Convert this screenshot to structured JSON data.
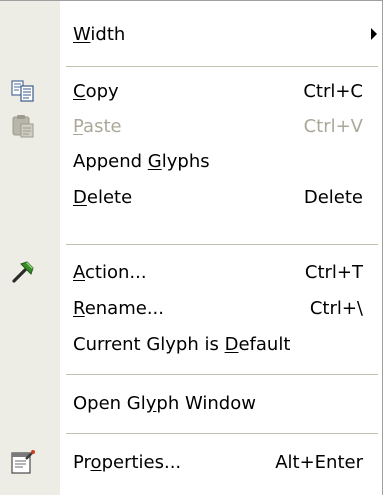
{
  "menu": {
    "items": [
      {
        "label": "Width",
        "mnemonic_index": 0,
        "shortcut": "",
        "submenu": true,
        "disabled": false,
        "icon": ""
      },
      {
        "label": "Copy",
        "mnemonic_index": 0,
        "shortcut": "Ctrl+C",
        "submenu": false,
        "disabled": false,
        "icon": "copy-icon"
      },
      {
        "label": "Paste",
        "mnemonic_index": 0,
        "shortcut": "Ctrl+V",
        "submenu": false,
        "disabled": true,
        "icon": "paste-icon"
      },
      {
        "label": "Append Glyphs",
        "mnemonic_index": 7,
        "shortcut": "",
        "submenu": false,
        "disabled": false,
        "icon": ""
      },
      {
        "label": "Delete",
        "mnemonic_index": 0,
        "shortcut": "Delete",
        "submenu": false,
        "disabled": false,
        "icon": ""
      },
      {
        "label": "Action...",
        "mnemonic_index": 0,
        "shortcut": "Ctrl+T",
        "submenu": false,
        "disabled": false,
        "icon": "hammer-icon"
      },
      {
        "label": "Rename...",
        "mnemonic_index": 0,
        "shortcut": "Ctrl+\\",
        "submenu": false,
        "disabled": false,
        "icon": ""
      },
      {
        "label": "Current Glyph is Default",
        "mnemonic_index": 17,
        "shortcut": "",
        "submenu": false,
        "disabled": false,
        "icon": ""
      },
      {
        "label": "Open Glyph Window",
        "mnemonic_index": 7,
        "shortcut": "",
        "submenu": false,
        "disabled": false,
        "icon": ""
      },
      {
        "label": "Properties...",
        "mnemonic_index": 2,
        "shortcut": "Alt+Enter",
        "submenu": false,
        "disabled": false,
        "icon": "properties-icon"
      }
    ]
  },
  "colors": {
    "gutter": "#eeede5",
    "disabled_text": "#aca899",
    "separator": "#c5c2b2"
  }
}
